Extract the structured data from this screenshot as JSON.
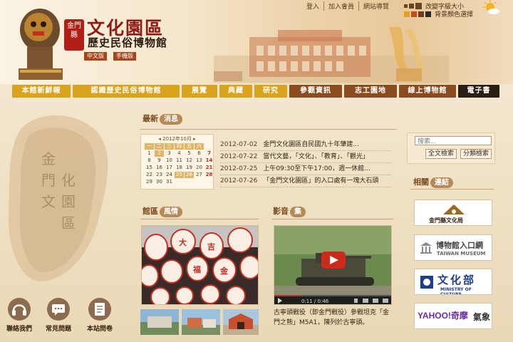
{
  "header": {
    "badge": "金門縣",
    "title": "文化園區",
    "subtitle": "歷史民俗博物館",
    "versions": [
      "中文版",
      "手機版"
    ],
    "top_links": [
      "登入",
      "加入會員",
      "網站導覽"
    ],
    "font_size_label": "改變字級大小",
    "bg_color_label": "背景顏色選擇"
  },
  "nav": {
    "items": [
      "本館新鮮報",
      "認識歷史民俗博物館",
      "展覽",
      "典藏",
      "研究",
      "參觀資訊",
      "志工園地",
      "線上博物館",
      "電子書"
    ]
  },
  "news": {
    "label": "最新",
    "pill": "消息",
    "calendar": {
      "title": "◂ 2012年10月 ▸",
      "weekdays": [
        "日",
        "一",
        "二",
        "三",
        "四",
        "五",
        "六"
      ],
      "days": [
        "",
        "1",
        "2",
        "3",
        "4",
        "5",
        "6",
        "7",
        "8",
        "9",
        "10",
        "11",
        "12",
        "13",
        "14",
        "15",
        "16",
        "17",
        "18",
        "19",
        "20",
        "21",
        "22",
        "23",
        "24",
        "25",
        "26",
        "27",
        "28",
        "29",
        "30",
        "31",
        "",
        ""
      ]
    },
    "items": [
      {
        "date": "2012-07-02",
        "text": "金門文化園區自民國九十年肇建..."
      },
      {
        "date": "2012-07-22",
        "text": "當代文藝，「文化」、「教育」、「觀光」"
      },
      {
        "date": "2012-07-25",
        "text": "上午09:30至下午17:00，週一休館..."
      },
      {
        "date": "2012-07-26",
        "text": "「金門文化園區」的入口處有一塊大石頭"
      }
    ]
  },
  "gallery": {
    "label": "館區",
    "pill": "風情"
  },
  "video": {
    "label": "影音",
    "pill": "集",
    "time": "0:11 / 0:46",
    "caption": "古寧頭戰役（即金門戰役）參戰坦克「金門之熊」M5A1，陳列於古寧頭。"
  },
  "search": {
    "placeholder": "搜索...",
    "buttons": [
      "全文檢索",
      "分類檢索"
    ]
  },
  "links": {
    "label": "相關",
    "pill": "連結",
    "banners": [
      {
        "name": "金門縣文化局"
      },
      {
        "name": "博物館入口網",
        "sub": "TAIWAN MUSEUM"
      },
      {
        "name": "文化部",
        "sub": "MINISTRY OF CULTURE"
      },
      {
        "name": "YAHOO!奇摩",
        "sub": "氣象"
      }
    ]
  },
  "bottom_icons": [
    "聯絡我們",
    "常見問題",
    "本站問卷"
  ],
  "colors": {
    "nav_gold": "#d9a31e",
    "nav_brown": "#8a4b1e",
    "nav_black": "#2b1f15",
    "title_red": "#8b1c16"
  }
}
